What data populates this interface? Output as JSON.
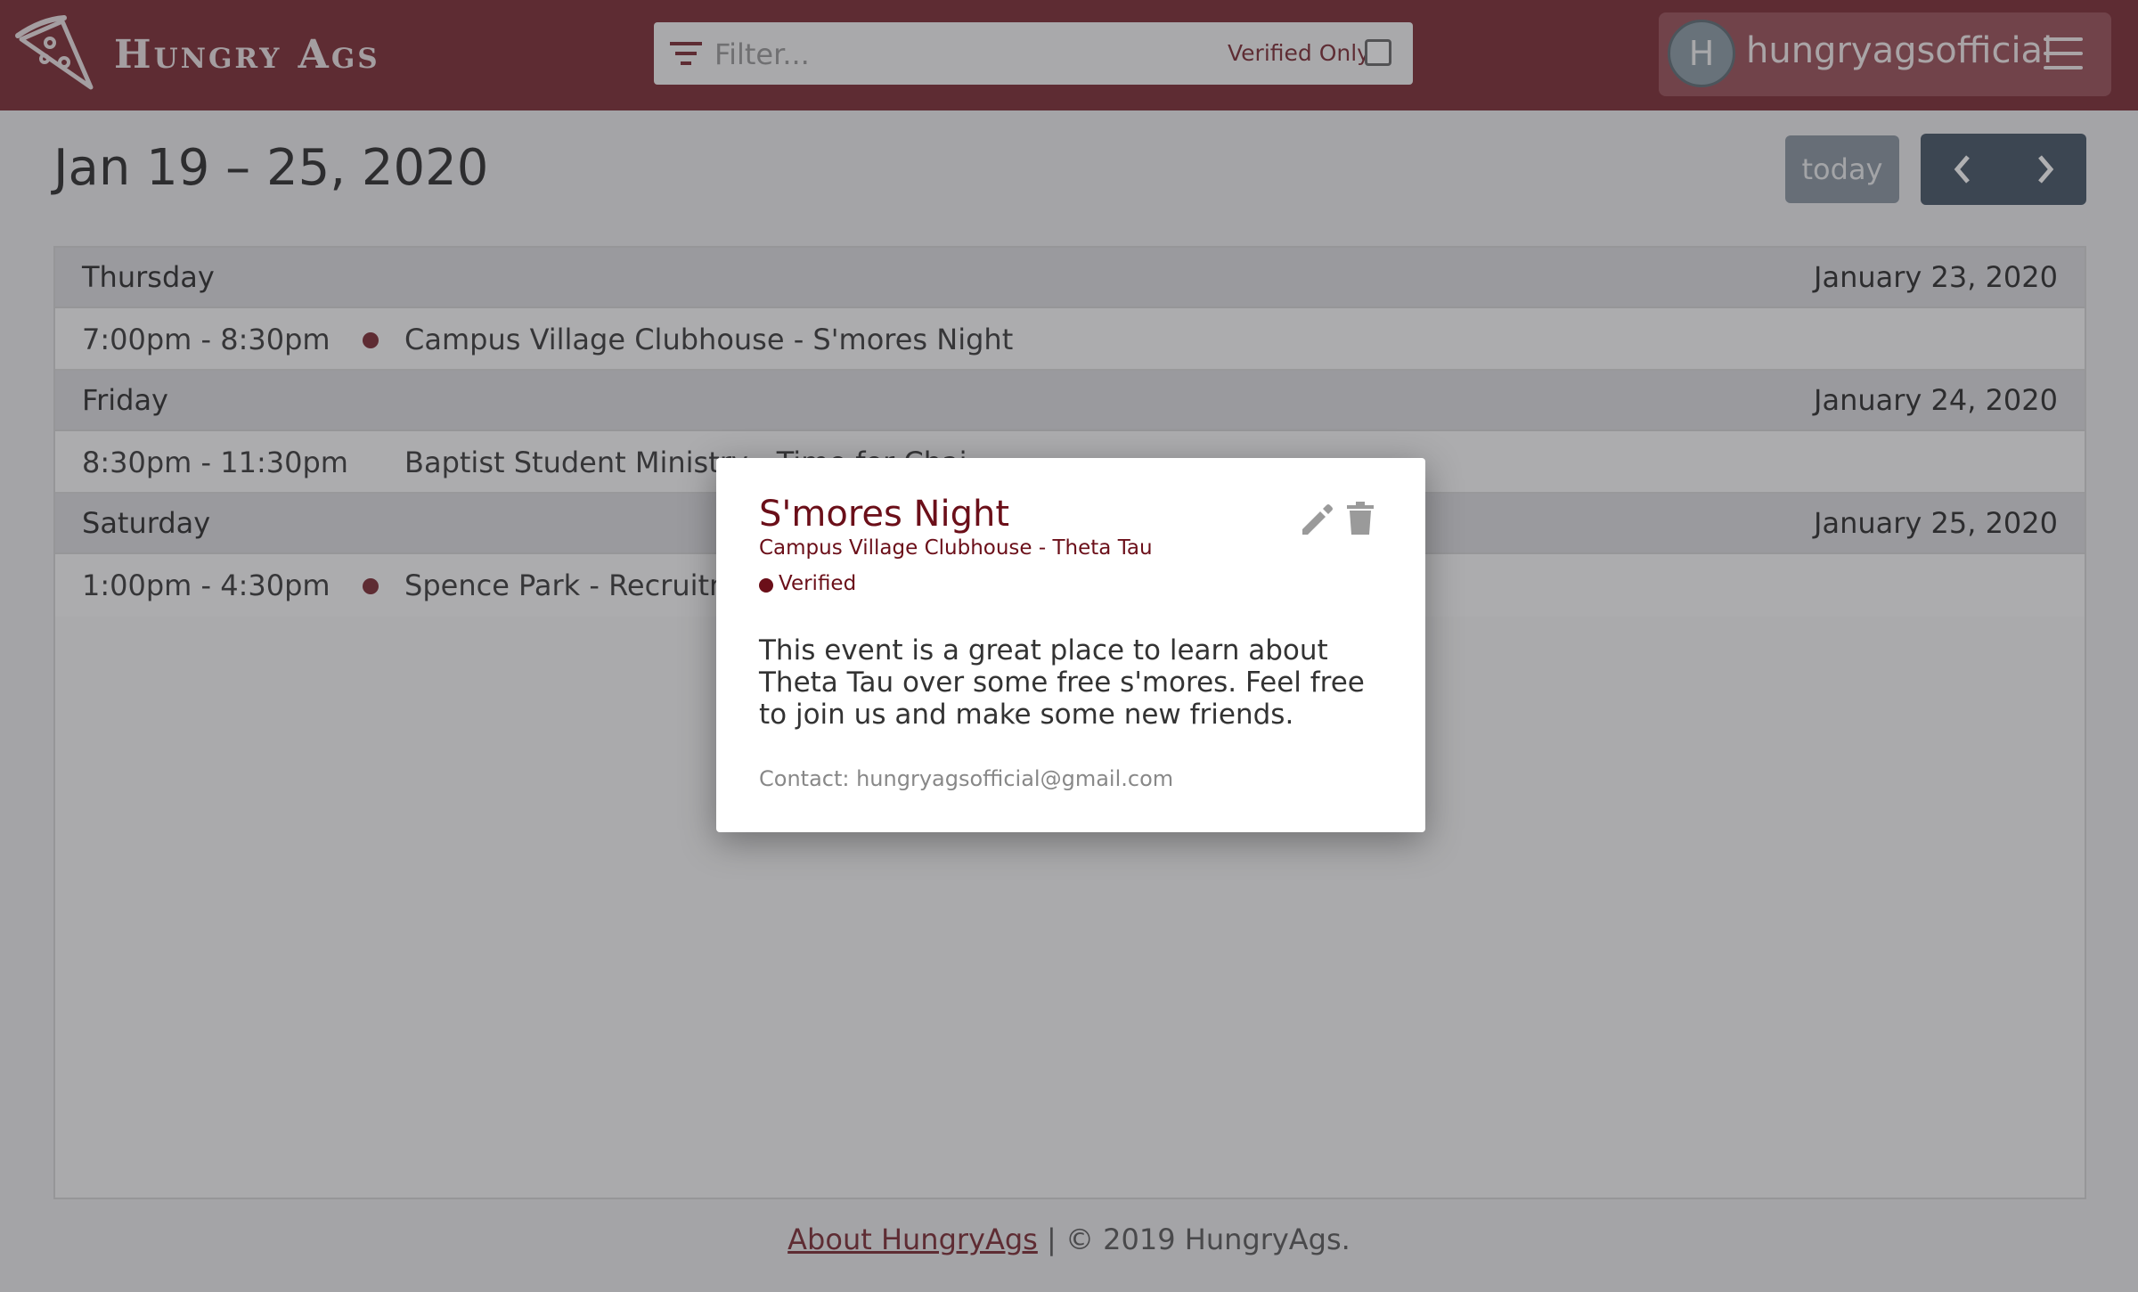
{
  "header": {
    "app_name": "Hungry Ags",
    "filter": {
      "placeholder": "Filter...",
      "value": "",
      "verified_only_label": "Verified Only",
      "verified_only_checked": false
    },
    "user": {
      "avatar_initial": "H",
      "username": "hungryagsofficial"
    }
  },
  "calendar": {
    "date_range": "Jan 19 – 25, 2020",
    "today_label": "today",
    "prev_icon": "chevron-left-icon",
    "next_icon": "chevron-right-icon",
    "days": [
      {
        "name": "Thursday",
        "date": "January 23, 2020",
        "events": [
          {
            "time": "7:00pm - 8:30pm",
            "title": "Campus Village Clubhouse - S'mores Night",
            "verified": true
          }
        ]
      },
      {
        "name": "Friday",
        "date": "January 24, 2020",
        "events": [
          {
            "time": "8:30pm - 11:30pm",
            "title": "Baptist Student Ministry - Time for Chai",
            "verified": false
          }
        ]
      },
      {
        "name": "Saturday",
        "date": "January 25, 2020",
        "events": [
          {
            "time": "1:00pm - 4:30pm",
            "title": "Spence Park - Recruitment",
            "verified": true
          }
        ]
      }
    ]
  },
  "footer": {
    "about_link": "About HungryAgs",
    "copyright": " | © 2019 HungryAgs."
  },
  "modal": {
    "title": "S'mores Night",
    "subtitle": "Campus Village Clubhouse - Theta Tau",
    "verified_label": "Verified",
    "description": "This event is a great place to learn about Theta Tau over some free s'mores. Feel free to join us and make some new friends.",
    "contact": "Contact: hungryagsofficial@gmail.com"
  },
  "colors": {
    "brand": "#6b0f19",
    "nav_dark": "#2c3e50",
    "today_btn": "#7b8894"
  }
}
